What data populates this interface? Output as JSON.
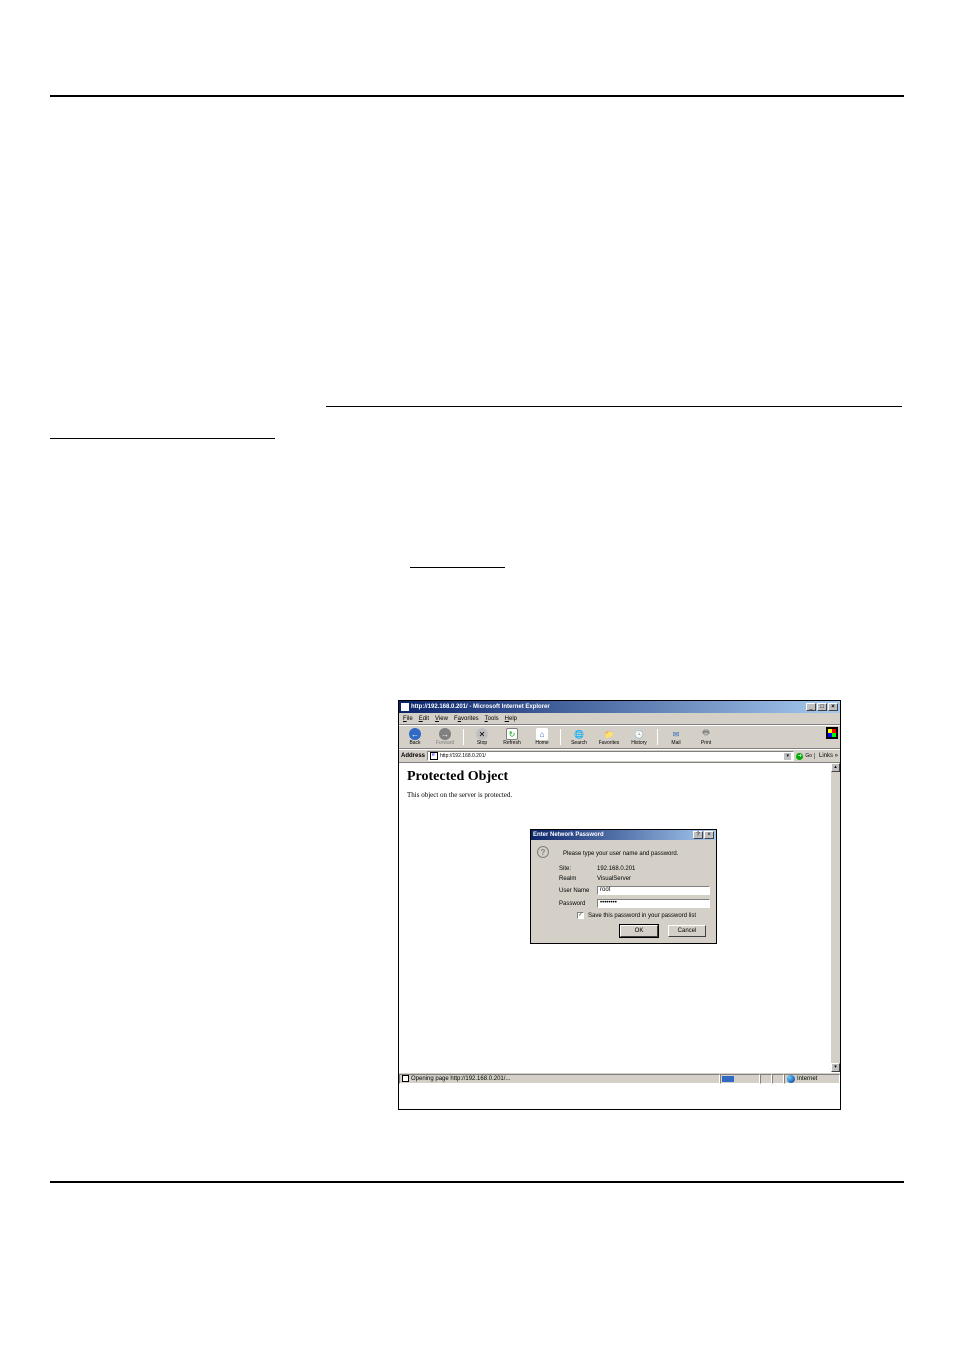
{
  "window": {
    "title": "http://192.168.0.201/ - Microsoft Internet Explorer",
    "minimize_label": "_",
    "maximize_label": "□",
    "close_label": "×"
  },
  "menu": {
    "file": "File",
    "edit": "Edit",
    "view": "View",
    "favorites": "Favorites",
    "tools": "Tools",
    "help": "Help"
  },
  "toolbar": {
    "back": "Back",
    "forward": "Forward",
    "stop": "Stop",
    "refresh": "Refresh",
    "home": "Home",
    "search": "Search",
    "favorites": "Favorites",
    "history": "History",
    "mail": "Mail",
    "print": "Print"
  },
  "addressbar": {
    "label": "Address",
    "value": "http://192.168.0.201/",
    "go_label": "Go",
    "links_label": "Links »"
  },
  "page": {
    "heading": "Protected Object",
    "text": "This object on the server is protected."
  },
  "dialog": {
    "title": "Enter Network Password",
    "help_label": "?",
    "close_label": "×",
    "instruction": "Please type your user name and password.",
    "site_label": "Site:",
    "site_value": "192.168.0.201",
    "realm_label": "Realm",
    "realm_value": "VisualServer",
    "user_label": "User Name",
    "user_value": "root",
    "pass_label": "Password",
    "pass_value": "••••••••",
    "save_label": "Save this password in your password list",
    "ok_label": "OK",
    "cancel_label": "Cancel"
  },
  "statusbar": {
    "text": "Opening page http://192.168.0.201/...",
    "zone": "Internet"
  }
}
